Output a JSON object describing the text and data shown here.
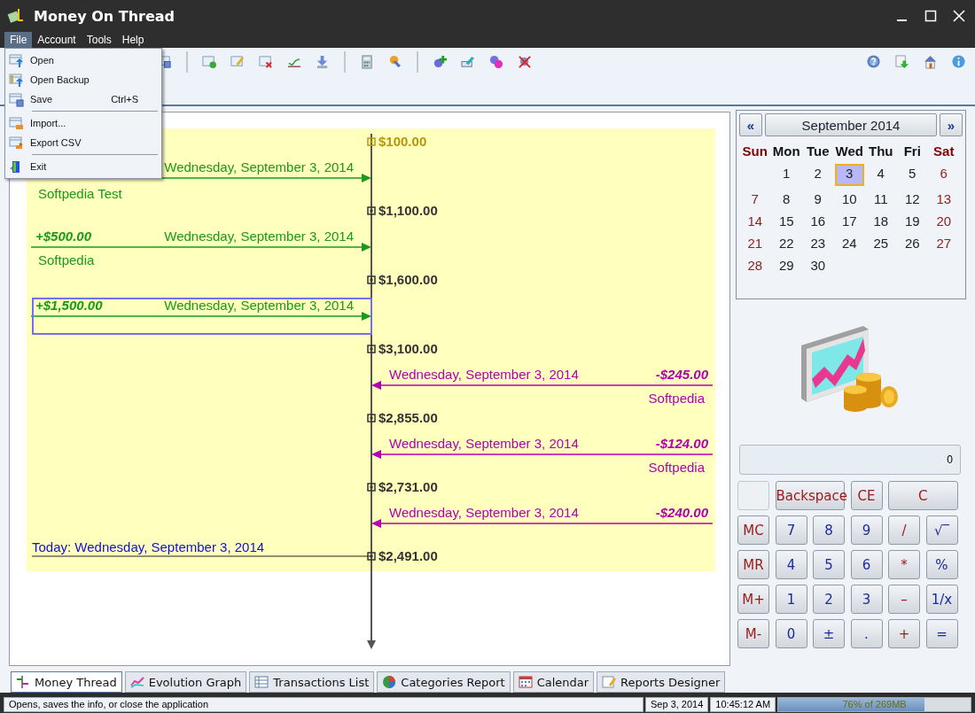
{
  "window": {
    "title": "Money On Thread"
  },
  "menubar": [
    {
      "label": "File",
      "selected": true
    },
    {
      "label": "Account",
      "selected": false
    },
    {
      "label": "Tools",
      "selected": false
    },
    {
      "label": "Help",
      "selected": false
    }
  ],
  "file_menu": {
    "items": [
      {
        "kind": "item",
        "label": "Open"
      },
      {
        "kind": "item",
        "label": "Open Backup"
      },
      {
        "kind": "item",
        "label": "Save",
        "shortcut": "Ctrl+S"
      },
      {
        "kind": "separator"
      },
      {
        "kind": "item",
        "label": "Import..."
      },
      {
        "kind": "item",
        "label": "Export CSV"
      },
      {
        "kind": "separator"
      },
      {
        "kind": "item",
        "label": "Exit"
      }
    ]
  },
  "timeline": {
    "items": [
      {
        "kind": "balance",
        "amount": "$100.00",
        "color": "#b8960a"
      },
      {
        "kind": "income",
        "date": "Wednesday, September 3, 2014",
        "name": "Softpedia Test",
        "selected": false
      },
      {
        "kind": "balance",
        "amount": "$1,100.00",
        "color": "#333333"
      },
      {
        "kind": "income",
        "amount": "+$500.00",
        "date": "Wednesday, September 3, 2014",
        "name": "Softpedia",
        "selected": false
      },
      {
        "kind": "balance",
        "amount": "$1,600.00",
        "color": "#333333"
      },
      {
        "kind": "income",
        "amount": "+$1,500.00",
        "date": "Wednesday, September 3, 2014",
        "selected": true
      },
      {
        "kind": "balance",
        "amount": "$3,100.00",
        "color": "#333333"
      },
      {
        "kind": "expense",
        "amount": "-$245.00",
        "date": "Wednesday, September 3, 2014",
        "name": "Softpedia",
        "selected": false
      },
      {
        "kind": "balance",
        "amount": "$2,855.00",
        "color": "#333333"
      },
      {
        "kind": "expense",
        "amount": "-$124.00",
        "date": "Wednesday, September 3, 2014",
        "name": "Softpedia",
        "selected": false
      },
      {
        "kind": "balance",
        "amount": "$2,731.00",
        "color": "#333333"
      },
      {
        "kind": "expense",
        "amount": "-$240.00",
        "date": "Wednesday, September 3, 2014",
        "selected": false
      },
      {
        "kind": "today",
        "label": "Today: Wednesday, September 3, 2014"
      },
      {
        "kind": "balance",
        "amount": "$2,491.00",
        "color": "#333333"
      }
    ]
  },
  "calendar": {
    "prev": "«",
    "month": "September 2014",
    "next": "»",
    "weekdays": [
      {
        "label": "Sun",
        "weekend": true
      },
      {
        "label": "Mon",
        "weekend": false
      },
      {
        "label": "Tue",
        "weekend": false
      },
      {
        "label": "Wed",
        "weekend": false
      },
      {
        "label": "Thu",
        "weekend": false
      },
      {
        "label": "Fri",
        "weekend": false
      },
      {
        "label": "Sat",
        "weekend": true
      }
    ],
    "weeks": [
      {
        "partial_start": true,
        "days": [
          {
            "label": "1",
            "weekend": false,
            "selected": false
          },
          {
            "label": "2",
            "weekend": false,
            "selected": false
          },
          {
            "label": "3",
            "weekend": false,
            "selected": true
          },
          {
            "label": "4",
            "weekend": false,
            "selected": false
          },
          {
            "label": "5",
            "weekend": false,
            "selected": false
          },
          {
            "label": "6",
            "weekend": true,
            "selected": false
          }
        ]
      },
      {
        "partial_start": false,
        "days": [
          {
            "label": "7",
            "weekend": true,
            "selected": false
          },
          {
            "label": "8",
            "weekend": false,
            "selected": false
          },
          {
            "label": "9",
            "weekend": false,
            "selected": false
          },
          {
            "label": "10",
            "weekend": false,
            "selected": false
          },
          {
            "label": "11",
            "weekend": false,
            "selected": false
          },
          {
            "label": "12",
            "weekend": false,
            "selected": false
          },
          {
            "label": "13",
            "weekend": true,
            "selected": false
          }
        ]
      },
      {
        "partial_start": false,
        "days": [
          {
            "label": "14",
            "weekend": true,
            "selected": false
          },
          {
            "label": "15",
            "weekend": false,
            "selected": false
          },
          {
            "label": "16",
            "weekend": false,
            "selected": false
          },
          {
            "label": "17",
            "weekend": false,
            "selected": false
          },
          {
            "label": "18",
            "weekend": false,
            "selected": false
          },
          {
            "label": "19",
            "weekend": false,
            "selected": false
          },
          {
            "label": "20",
            "weekend": true,
            "selected": false
          }
        ]
      },
      {
        "partial_start": false,
        "days": [
          {
            "label": "21",
            "weekend": true,
            "selected": false
          },
          {
            "label": "22",
            "weekend": false,
            "selected": false
          },
          {
            "label": "23",
            "weekend": false,
            "selected": false
          },
          {
            "label": "24",
            "weekend": false,
            "selected": false
          },
          {
            "label": "25",
            "weekend": false,
            "selected": false
          },
          {
            "label": "26",
            "weekend": false,
            "selected": false
          },
          {
            "label": "27",
            "weekend": true,
            "selected": false
          }
        ]
      },
      {
        "partial_start": false,
        "days": [
          {
            "label": "28",
            "weekend": true,
            "selected": false
          },
          {
            "label": "29",
            "weekend": false,
            "selected": false
          },
          {
            "label": "30",
            "weekend": false,
            "selected": false
          }
        ]
      }
    ]
  },
  "calculator": {
    "display": "0",
    "buttons": [
      {
        "kind": "blank",
        "wide": false
      },
      {
        "kind": "edit",
        "label": "Backspace",
        "wide": true
      },
      {
        "kind": "edit",
        "label": "CE",
        "wide": false
      },
      {
        "kind": "edit",
        "label": "C",
        "wide": true
      },
      {
        "kind": "memory",
        "label": "MC",
        "wide": false
      },
      {
        "kind": "digit",
        "label": "7",
        "wide": false
      },
      {
        "kind": "digit",
        "label": "8",
        "wide": false
      },
      {
        "kind": "digit",
        "label": "9",
        "wide": false
      },
      {
        "kind": "operator",
        "label": "/",
        "wide": false
      },
      {
        "kind": "function",
        "label": "√‾",
        "wide": false
      },
      {
        "kind": "memory",
        "label": "MR",
        "wide": false
      },
      {
        "kind": "digit",
        "label": "4",
        "wide": false
      },
      {
        "kind": "digit",
        "label": "5",
        "wide": false
      },
      {
        "kind": "digit",
        "label": "6",
        "wide": false
      },
      {
        "kind": "operator",
        "label": "*",
        "wide": false
      },
      {
        "kind": "function",
        "label": "%",
        "wide": false
      },
      {
        "kind": "memory",
        "label": "M+",
        "wide": false
      },
      {
        "kind": "digit",
        "label": "1",
        "wide": false
      },
      {
        "kind": "digit",
        "label": "2",
        "wide": false
      },
      {
        "kind": "digit",
        "label": "3",
        "wide": false
      },
      {
        "kind": "operator",
        "label": "–",
        "wide": false
      },
      {
        "kind": "function",
        "label": "1/x",
        "wide": false
      },
      {
        "kind": "memory",
        "label": "M-",
        "wide": false
      },
      {
        "kind": "digit",
        "label": "0",
        "wide": false
      },
      {
        "kind": "function",
        "label": "±",
        "wide": false
      },
      {
        "kind": "function",
        "label": ".",
        "wide": false
      },
      {
        "kind": "operator",
        "label": "+",
        "wide": false
      },
      {
        "kind": "function",
        "label": "=",
        "wide": false
      }
    ]
  },
  "tabs": [
    {
      "label": "Money Thread",
      "selected": true
    },
    {
      "label": "Evolution Graph",
      "selected": false
    },
    {
      "label": "Transactions List",
      "selected": false
    },
    {
      "label": "Categories Report",
      "selected": false
    },
    {
      "label": "Calendar",
      "selected": false
    },
    {
      "label": "Reports Designer",
      "selected": false
    }
  ],
  "status_bar": {
    "message": "Opens, saves the info, or close the application",
    "date": "Sep 3, 2014",
    "time": "10:45:12 AM",
    "memory": {
      "level": 0.76,
      "reading": "76% of 269MB"
    }
  }
}
